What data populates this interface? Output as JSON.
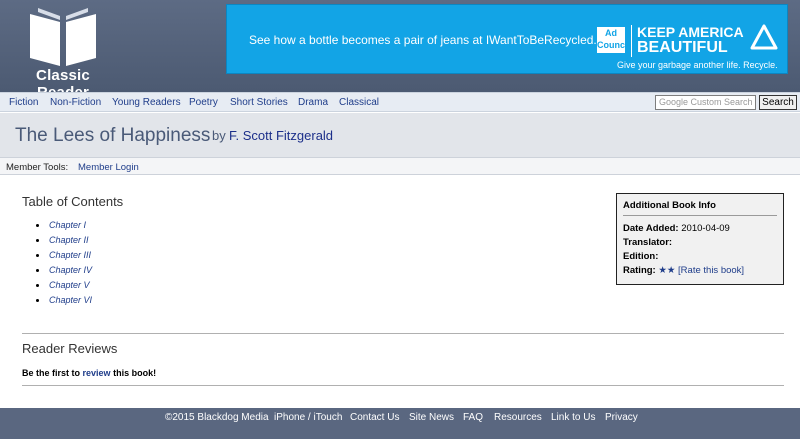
{
  "header": {
    "logo_text": "Classic Reader",
    "ad": {
      "text": "See how a bottle becomes a pair of jeans at IWantToBeRecycled.org",
      "logo_text": "Ad Council",
      "brand_line1": "KEEP AMERICA",
      "brand_line2": "BEAUTIFUL",
      "tagline": "Give your garbage another life. Recycle."
    }
  },
  "nav": {
    "items": [
      "Fiction",
      "Non-Fiction",
      "Young Readers",
      "Poetry",
      "Short Stories",
      "Drama",
      "Classical"
    ],
    "search_placeholder": "Google Custom Search",
    "search_button": "Search"
  },
  "book": {
    "title": "The Lees of Happiness",
    "by": "by",
    "author": "F. Scott Fitzgerald"
  },
  "member_tools": {
    "label": "Member Tools:",
    "login": "Member Login"
  },
  "toc": {
    "heading": "Table of Contents",
    "chapters": [
      "Chapter I",
      "Chapter II",
      "Chapter III",
      "Chapter IV",
      "Chapter V",
      "Chapter VI"
    ]
  },
  "info": {
    "title": "Additional Book Info",
    "date_label": "Date Added:",
    "date_value": "2010-04-09",
    "translator_label": "Translator:",
    "edition_label": "Edition:",
    "rating_label": "Rating:",
    "rating_stars": "★★",
    "rate_link": "[Rate this book]"
  },
  "reviews": {
    "heading": "Reader Reviews",
    "prefix": "Be the first to",
    "link": "review",
    "suffix": "this book!"
  },
  "footer": {
    "items": [
      "©2015 Blackdog Media",
      "iPhone / iTouch",
      "Contact Us",
      "Site News",
      "FAQ",
      "Resources",
      "Link to Us",
      "Privacy"
    ]
  },
  "colors": {
    "header_bg": "#4f5d76",
    "ad_bg": "#12a4e6",
    "link": "#1f3d8a",
    "footer_bg": "#5a6780"
  }
}
